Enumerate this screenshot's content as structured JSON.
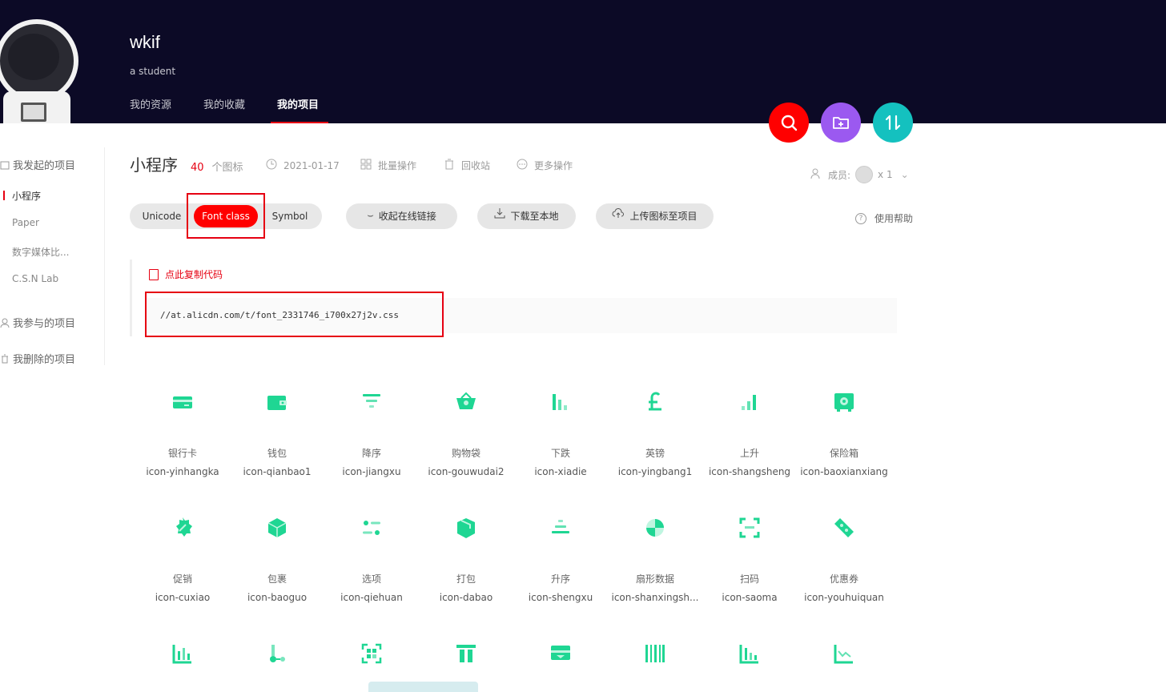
{
  "header": {
    "username": "wkif",
    "subtitle": "a student",
    "nav": [
      "我的资源",
      "我的收藏",
      "我的项目"
    ]
  },
  "sidebar": {
    "initiated": "我发起的项目",
    "projects": [
      "小程序",
      "Paper",
      "数字媒体比...",
      "C.S.N Lab"
    ],
    "joined": "我参与的项目",
    "deleted": "我删除的项目"
  },
  "project": {
    "title": "小程序",
    "count": "40",
    "count_unit": "个图标",
    "date": "2021-01-17",
    "batch": "批量操作",
    "recycle": "回收站",
    "more": "更多操作",
    "member_label": "成员:",
    "member_count": "x 1"
  },
  "tabs": [
    "Unicode",
    "Font class",
    "Symbol"
  ],
  "actions": {
    "collapse": "收起在线链接",
    "download": "下载至本地",
    "upload": "上传图标至项目",
    "help": "使用帮助"
  },
  "code": {
    "copy": "点此复制代码",
    "url": "//at.alicdn.com/t/font_2331746_i700x27j2v.css"
  },
  "colors": {
    "accent": "#e60012",
    "icon": "#1fd693",
    "header_bg": "#0c0a26"
  },
  "icons": [
    {
      "cn": "银行卡",
      "en": "icon-yinhangka",
      "glyph": "card-icon"
    },
    {
      "cn": "钱包",
      "en": "icon-qianbao1",
      "glyph": "wallet-icon"
    },
    {
      "cn": "降序",
      "en": "icon-jiangxu",
      "glyph": "sort-desc-icon"
    },
    {
      "cn": "购物袋",
      "en": "icon-gouwudai2",
      "glyph": "shopping-bag-icon"
    },
    {
      "cn": "下跌",
      "en": "icon-xiadie",
      "glyph": "trend-down-icon"
    },
    {
      "cn": "英镑",
      "en": "icon-yingbang1",
      "glyph": "pound-icon"
    },
    {
      "cn": "上升",
      "en": "icon-shangsheng",
      "glyph": "trend-up-icon"
    },
    {
      "cn": "保险箱",
      "en": "icon-baoxianxiang",
      "glyph": "safe-icon"
    },
    {
      "cn": "促销",
      "en": "icon-cuxiao",
      "glyph": "promotion-icon"
    },
    {
      "cn": "包裹",
      "en": "icon-baoguo",
      "glyph": "package-icon"
    },
    {
      "cn": "选项",
      "en": "icon-qiehuan",
      "glyph": "options-icon"
    },
    {
      "cn": "打包",
      "en": "icon-dabao",
      "glyph": "pack-icon"
    },
    {
      "cn": "升序",
      "en": "icon-shengxu",
      "glyph": "sort-asc-icon"
    },
    {
      "cn": "扇形数据",
      "en": "icon-shanxingsh...",
      "glyph": "pie-chart-icon"
    },
    {
      "cn": "扫码",
      "en": "icon-saoma",
      "glyph": "scan-icon"
    },
    {
      "cn": "优惠券",
      "en": "icon-youhuiquan",
      "glyph": "coupon-icon"
    },
    {
      "glyph": "bar-chart-icon"
    },
    {
      "glyph": "node-icon"
    },
    {
      "glyph": "qrcode-icon"
    },
    {
      "glyph": "column-icon"
    },
    {
      "glyph": "receipt-icon"
    },
    {
      "glyph": "barcode-icon"
    },
    {
      "glyph": "bar-chart-2-icon"
    },
    {
      "glyph": "line-chart-icon"
    }
  ]
}
